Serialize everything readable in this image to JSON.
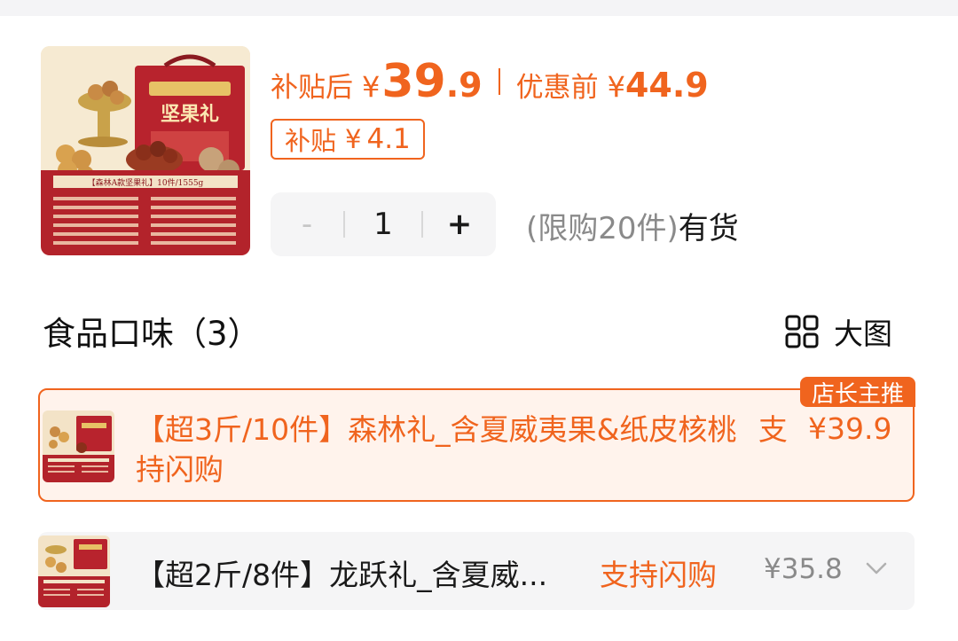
{
  "product": {
    "image_alt": "坚果礼盒",
    "box_text": "坚果礼",
    "box_banner": "【森林A款坚果礼】10件/1555g",
    "price_after_label": "补贴后",
    "currency": "¥",
    "price_after_int": "39",
    "price_after_dec": ".9",
    "price_before_label": "优惠前",
    "price_before": "44.9",
    "subsidy_label": "补贴",
    "subsidy_value": "4.1"
  },
  "quantity": {
    "minus": "-",
    "value": "1",
    "plus": "+",
    "limit_text": "(限购20件)",
    "stock_text": "有货"
  },
  "flavors": {
    "title": "食品口味（3）",
    "view_toggle_label": "大图"
  },
  "variants": [
    {
      "name": "【超3斤/10件】森林礼_含夏威夷果&纸皮核桃",
      "flash": "支持闪购",
      "price": "¥39.9",
      "badge": "店长主推",
      "selected": true
    },
    {
      "name": "【超2斤/8件】龙跃礼_含夏威...",
      "flash": "支持闪购",
      "price": "¥35.8",
      "selected": false
    }
  ],
  "colors": {
    "accent": "#f0641e",
    "selected_bg": "#fff3ec",
    "muted": "#8a8a8a",
    "box_red": "#b3232b"
  }
}
